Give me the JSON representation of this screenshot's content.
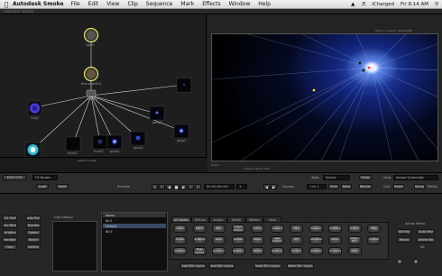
{
  "menubar": {
    "app_name": "Autodesk Smoke",
    "menus": [
      "File",
      "Edit",
      "View",
      "Clip",
      "Sequence",
      "Mark",
      "Effects",
      "Window",
      "Help"
    ],
    "status_user": "iCharged",
    "clock": "Fri 9:14 AM"
  },
  "window": {
    "title": "Autodesk Smoke"
  },
  "schematic": {
    "nodes": {
      "light": "light1",
      "glow": "glow1",
      "blendfx": "blendAddFx1",
      "comp": "action1",
      "ring": "ring1",
      "front1": "front",
      "front2": "front2",
      "front3": "front3",
      "glow2": "glow2",
      "glow3": "glow3",
      "glow4": "glow4",
      "glow5": "glow5"
    }
  },
  "viewer": {
    "top_info": "action1 output: 1920x1080",
    "left_info": "action1 action",
    "bottom_left": "Action",
    "bottom_info": "Frame 1  Zoom 25%"
  },
  "transport": {
    "exit_button": "EXIT CFX",
    "fx_nodes_dropdown": "FX Nodes",
    "load_button": "Load",
    "save_button": "Save",
    "preview_label": "Preview",
    "timecode": "00:00:00+00",
    "frame_field": "1",
    "frames_label": "Frames",
    "range_field": "1 to 1",
    "prev_button": "Prev",
    "next_button": "Next",
    "tools_label": "Tools",
    "tools_dropdown": "Select",
    "undo_button": "Undo",
    "view_label": "View",
    "view_dropdown": "Action Schematic",
    "render_button": "Render",
    "grid_label": "Grid",
    "reset_button": "Reset",
    "media_label": "Media",
    "setup_button": "Setup"
  },
  "left_controls": {
    "buttons": [
      "CFX Prefs",
      "Node Prefs",
      "Solo Node",
      "Bypass",
      "Introduce",
      "Speed",
      "Iteration",
      "Reset",
      "Copy",
      "Delete"
    ],
    "clip_history": "Clip History"
  },
  "bins": {
    "header": "Name",
    "rows": [
      "Bin1",
      "Default",
      "Bin3"
    ]
  },
  "node_tabs": [
    "All Nodes",
    "Effects",
    "Action",
    "Utility",
    "Mattes",
    "Vars"
  ],
  "node_bin_items": [
    "Action",
    "Blend",
    "Blur",
    "Colour Warper",
    "Comp",
    "Compound",
    "Deal",
    "Degrain",
    "Displace",
    "Distort",
    "Edge",
    "Erode",
    "Expressions",
    "Glow",
    "Gmask",
    "Keyer",
    "Lens Distort",
    "LUT",
    "Matchbox",
    "Mono",
    "Motion Blur",
    "Output",
    "Particles",
    "Pixel Spread",
    "Recursive",
    "Regrain",
    "Resize",
    "Reverse",
    "Sparks",
    "Stabilizer",
    "Timewarp",
    "Warp"
  ],
  "bottom_buttons": {
    "load_bin": "Load Bin Layout",
    "save_bin": "Save Bin Layout",
    "reset_bin": "Reset Bin Layout",
    "delete_bin": "Delete Bin Layout"
  },
  "right_panel": {
    "title": "Action Menu",
    "auto_key": "Auto Key",
    "set_key": "Set Key",
    "delete_key": "Delete Key",
    "reset": "Reset",
    "all_label": "All"
  },
  "colors": {
    "menubar_bg": "#e6e6e6",
    "panel_bg": "#1e1e1e",
    "glow_blue": "#3c6ef0",
    "node_highlight": "#e6e07a"
  }
}
